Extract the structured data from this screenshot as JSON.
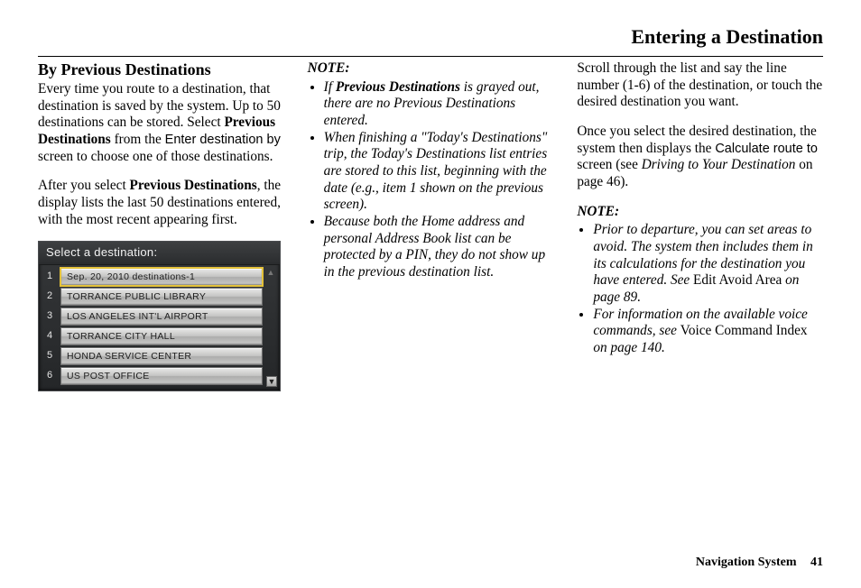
{
  "page_title": "Entering a Destination",
  "section_heading": "By Previous Destinations",
  "col1": {
    "p1_a": "Every time you route to a destination, that destination is saved by the system. Up to 50 destinations can be stored. Select ",
    "p1_b": "Previous Destinations",
    "p1_c": " from the ",
    "p1_d": "Enter destination by",
    "p1_e": " screen to choose one of those destinations.",
    "p2_a": "After you select ",
    "p2_b": "Previous Destinations",
    "p2_c": ", the display lists the last 50 destinations entered, with the most recent appearing first."
  },
  "device": {
    "header": "Select a destination:",
    "rows": [
      {
        "num": "1",
        "label": "Sep. 20, 2010 destinations-1",
        "selected": true
      },
      {
        "num": "2",
        "label": "TORRANCE PUBLIC LIBRARY",
        "selected": false
      },
      {
        "num": "3",
        "label": "LOS ANGELES INT'L AIRPORT",
        "selected": false
      },
      {
        "num": "4",
        "label": "TORRANCE CITY HALL",
        "selected": false
      },
      {
        "num": "5",
        "label": "HONDA SERVICE CENTER",
        "selected": false
      },
      {
        "num": "6",
        "label": "US POST OFFICE",
        "selected": false
      }
    ],
    "scroll_up": "▲",
    "scroll_down": "▼"
  },
  "col2": {
    "note_label": "NOTE:",
    "n1_a": "If ",
    "n1_b": "Previous Destinations",
    "n1_c": " is grayed out, there are no Previous Destinations entered.",
    "n2": "When finishing a \"Today's Destinations\" trip, the Today's Destinations list entries are stored to this list, beginning with the date (e.g., item 1 shown on the previous screen).",
    "n3": "Because both the Home address and personal Address Book list can be protected by a PIN, they do not show up in the previous destination list."
  },
  "col3": {
    "p1": "Scroll through the list and say the line number (1-6) of the destination, or touch the desired destination you want.",
    "p2_a": "Once you select the desired destination, the system then displays the ",
    "p2_b": "Calculate route to",
    "p2_c": " screen (see ",
    "p2_d": "Driving to Your Destination",
    "p2_e": " on page 46).",
    "note_label": "NOTE:",
    "n1_a": "Prior to departure, you can set areas to avoid. The system then includes them in its calculations for the destination you have entered. See ",
    "n1_b": "Edit Avoid Area",
    "n1_c": " on page 89.",
    "n2_a": "For information on the available voice commands, see ",
    "n2_b": "Voice Command Index",
    "n2_c": " on page 140."
  },
  "footer": {
    "label": "Navigation System",
    "page": "41"
  }
}
